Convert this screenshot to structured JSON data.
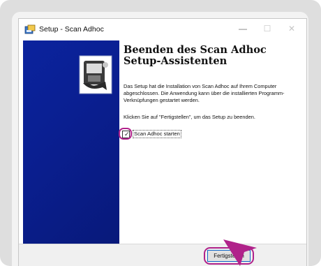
{
  "window": {
    "title": "Setup - Scan Adhoc",
    "minimize_glyph": "—",
    "maximize_glyph": "☐",
    "close_glyph": "✕"
  },
  "content": {
    "heading": "Beenden des Scan Adhoc Setup-Assistenten",
    "paragraph1": "Das Setup hat die Installation von Scan Adhoc auf Ihrem Computer abgeschlossen. Die Anwendung kann über die installierten Programm-Verknüpfungen gestartet werden.",
    "paragraph2": "Klicken Sie auf \"Fertigstellen\", um das Setup zu beenden.",
    "checkbox_label": "Scan Adhoc starten",
    "checkbox_checked": true
  },
  "footer": {
    "finish_label": "Fertigstellen"
  },
  "colors": {
    "highlight": "#b0228a",
    "banner": "#0a1f91",
    "focus": "#0f67c9"
  },
  "icons": [
    "setup-app-icon",
    "installer-logo-icon",
    "checkmark-icon",
    "pointer-arrow-icon"
  ]
}
